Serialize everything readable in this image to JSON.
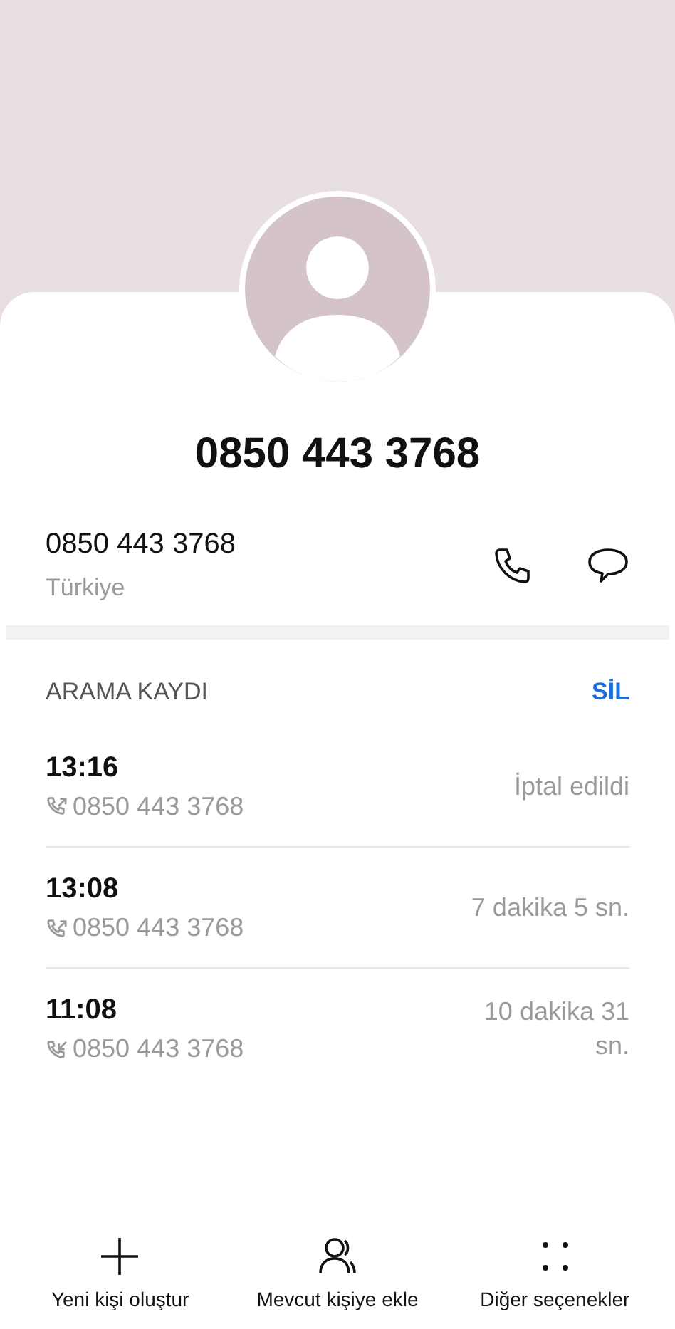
{
  "contact": {
    "title": "0850 443 3768"
  },
  "number": {
    "value": "0850 443 3768",
    "region": "Türkiye"
  },
  "call_log": {
    "heading": "ARAMA KAYDI",
    "delete_label": "SİL",
    "entries": [
      {
        "time": "13:16",
        "number": "0850 443 3768",
        "status": "İptal edildi",
        "kind": "outgoing"
      },
      {
        "time": "13:08",
        "number": "0850 443 3768",
        "status": "7 dakika 5 sn.",
        "kind": "outgoing"
      },
      {
        "time": "11:08",
        "number": "0850 443 3768",
        "status": "10 dakika 31 sn.",
        "kind": "incoming"
      }
    ]
  },
  "actions": [
    {
      "label": "Yeni kişi oluştur",
      "kind": "add"
    },
    {
      "label": "Mevcut kişiye ekle",
      "kind": "contact"
    },
    {
      "label": "Diğer seçenekler",
      "kind": "more"
    }
  ]
}
